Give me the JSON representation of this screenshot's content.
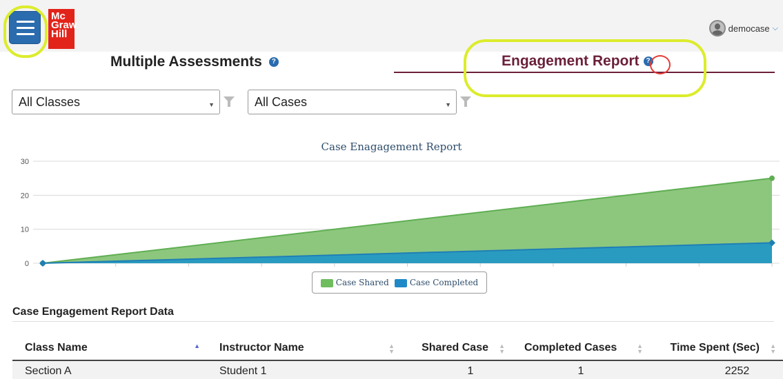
{
  "header": {
    "username": "democase",
    "logo_lines": [
      "Mc",
      "Graw",
      "Hill"
    ]
  },
  "tabs": [
    {
      "label": "Multiple Assessments",
      "help": "?"
    },
    {
      "label": "Engagement Report",
      "help": "?",
      "active": true
    }
  ],
  "filters": {
    "classes": "All Classes",
    "cases": "All Cases"
  },
  "chart_data": {
    "type": "area",
    "title": "Case Enagagement Report",
    "x": [
      0,
      1
    ],
    "ylim": [
      0,
      30
    ],
    "yticks": [
      0,
      10,
      20,
      30
    ],
    "grid": true,
    "legend": "bottom",
    "series": [
      {
        "name": "Case Shared",
        "values": [
          0,
          25
        ],
        "color": "#8dc77e",
        "line": "#5fae52"
      },
      {
        "name": "Case Completed",
        "values": [
          0,
          6
        ],
        "color": "#2a9bc0",
        "line": "#1f7fb5"
      }
    ]
  },
  "table": {
    "title": "Case Engagement Report Data",
    "columns": [
      "Class Name",
      "Instructor Name",
      "Shared Case",
      "Completed Cases",
      "Time Spent (Sec)"
    ],
    "rows": [
      [
        "Section A",
        "Student 1",
        "1",
        "1",
        "2252"
      ]
    ]
  }
}
